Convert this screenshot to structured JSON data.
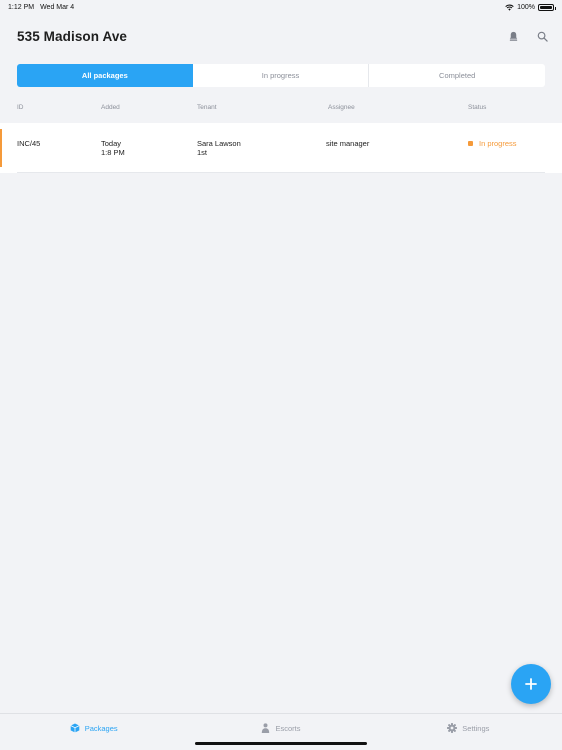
{
  "status_bar": {
    "time": "1:12 PM",
    "date": "Wed Mar 4",
    "battery": "100%"
  },
  "header": {
    "title": "535 Madison Ave"
  },
  "filters": [
    {
      "label": "All packages",
      "active": true
    },
    {
      "label": "In progress",
      "active": false
    },
    {
      "label": "Completed",
      "active": false
    }
  ],
  "columns": {
    "id": "ID",
    "added": "Added",
    "tenant": "Tenant",
    "assignee": "Assignee",
    "status": "Status"
  },
  "rows": [
    {
      "id": "INC/45",
      "added_day": "Today",
      "added_time": "1:8 PM",
      "tenant_name": "Sara Lawson",
      "tenant_unit": "1st",
      "assignee": "site manager",
      "status": "In progress"
    }
  ],
  "tabs": [
    {
      "label": "Packages",
      "icon": "package-icon",
      "active": true
    },
    {
      "label": "Escorts",
      "icon": "person-icon",
      "active": false
    },
    {
      "label": "Settings",
      "icon": "gear-icon",
      "active": false
    }
  ],
  "colors": {
    "accent": "#2aa4f4",
    "status_in_progress": "#f59a3a"
  }
}
